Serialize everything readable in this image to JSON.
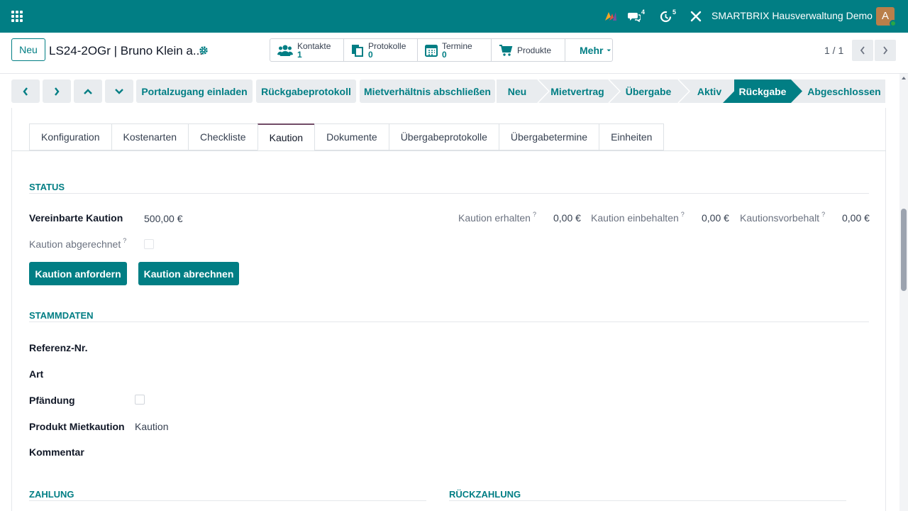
{
  "navbar": {
    "messages_count": "4",
    "activities_count": "5",
    "company": "SMARTBRIX Hausverwaltung Demo",
    "avatar_letter": "A",
    "brand_color": "#017e84"
  },
  "control": {
    "new_label": "Neu",
    "record_title": "LS24-2OGr | Bruno Klein a...",
    "smart_buttons": [
      {
        "label": "Kontakte",
        "value": "1",
        "icon": "users-icon"
      },
      {
        "label": "Protokolle",
        "value": "0",
        "icon": "documents-icon"
      },
      {
        "label": "Termine",
        "value": "0",
        "icon": "calendar-icon"
      },
      {
        "label": "Produkte",
        "value": "",
        "icon": "cart-icon"
      }
    ],
    "more_label": "Mehr",
    "pager": "1 / 1"
  },
  "actions": {
    "buttons": [
      "Portalzugang einladen",
      "Rückgabeprotokoll",
      "Mietverhältnis abschließen"
    ],
    "stages": [
      "Neu",
      "Mietvertrag",
      "Übergabe",
      "Aktiv",
      "Rückgabe",
      "Abgeschlossen"
    ],
    "active_stage": "Rückgabe"
  },
  "tabs": [
    "Konfiguration",
    "Kostenarten",
    "Checkliste",
    "Kaution",
    "Dokumente",
    "Übergabeprotokolle",
    "Übergabetermine",
    "Einheiten"
  ],
  "active_tab": "Kaution",
  "status": {
    "title": "STATUS",
    "agreed_label": "Vereinbarte Kaution",
    "agreed_value": "500,00 €",
    "settled_label": "Kaution abgerechnet",
    "received_label": "Kaution erhalten",
    "received_value": "0,00 €",
    "retained_label": "Kaution einbehalten",
    "retained_value": "0,00 €",
    "reserve_label": "Kautionsvorbehalt",
    "reserve_value": "0,00 €",
    "request_button": "Kaution anfordern",
    "settle_button": "Kaution abrechnen"
  },
  "master": {
    "title": "STAMMDATEN",
    "ref_label": "Referenz-Nr.",
    "type_label": "Art",
    "seizure_label": "Pfändung",
    "product_label": "Produkt Mietkaution",
    "product_value": "Kaution",
    "comment_label": "Kommentar"
  },
  "payment": {
    "title": "ZAHLUNG",
    "repayment_title": "RÜCKZAHLUNG"
  }
}
